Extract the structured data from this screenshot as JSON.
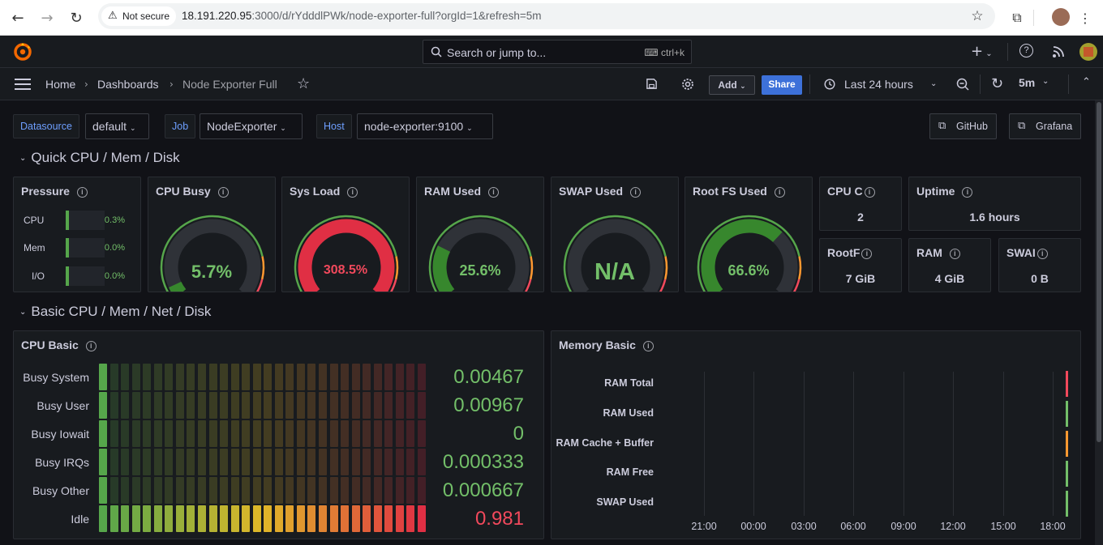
{
  "browser": {
    "secure_label": "Not secure",
    "url_host": "18.191.220.95",
    "url_rest": ":3000/d/rYdddlPWk/node-exporter-full?orgId=1&refresh=5m"
  },
  "topbar": {
    "search_placeholder": "Search or jump to...",
    "search_shortcut": "ctrl+k"
  },
  "breadcrumb": {
    "home": "Home",
    "dashboards": "Dashboards",
    "current": "Node Exporter Full"
  },
  "toolbar": {
    "add_label": "Add",
    "share_label": "Share",
    "time_range": "Last 24 hours",
    "refresh_interval": "5m"
  },
  "variables": {
    "datasource_label": "Datasource",
    "datasource_value": "default",
    "job_label": "Job",
    "job_value": "NodeExporter",
    "host_label": "Host",
    "host_value": "node-exporter:9100"
  },
  "links": {
    "github": "GitHub",
    "grafana": "Grafana"
  },
  "rows": {
    "quick": "Quick CPU / Mem / Disk",
    "basic": "Basic CPU / Mem / Net / Disk"
  },
  "colors": {
    "green": "#73bf69",
    "red": "#f2495c",
    "orange": "#ff9830",
    "accent": "#3d71d9"
  },
  "panels": {
    "pressure": {
      "title": "Pressure",
      "rows": [
        {
          "label": "CPU",
          "value": "0.3%"
        },
        {
          "label": "Mem",
          "value": "0.0%"
        },
        {
          "label": "I/O",
          "value": "0.0%"
        }
      ]
    },
    "cpu_busy": {
      "title": "CPU Busy",
      "value": "5.7%",
      "fraction": 0.057,
      "color": "#73bf69"
    },
    "sys_load": {
      "title": "Sys Load",
      "value": "308.5%",
      "fraction": 1.0,
      "color": "#f2495c"
    },
    "ram_used": {
      "title": "RAM Used",
      "value": "25.6%",
      "fraction": 0.256,
      "color": "#73bf69"
    },
    "swap_used": {
      "title": "SWAP Used",
      "value": "N/A",
      "fraction": 0,
      "color": "#73bf69"
    },
    "root_fs": {
      "title": "Root FS Used",
      "value": "66.6%",
      "fraction": 0.666,
      "color": "#73bf69"
    },
    "cpu_cores": {
      "title": "CPU C",
      "value": "2"
    },
    "uptime": {
      "title": "Uptime",
      "value": "1.6 hours"
    },
    "rootfs_total": {
      "title": "RootF",
      "value": "7 GiB"
    },
    "ram_total": {
      "title": "RAM",
      "value": "4 GiB"
    },
    "swap_total": {
      "title": "SWAI",
      "value": "0 B"
    },
    "cpu_basic": {
      "title": "CPU Basic",
      "items": [
        {
          "label": "Busy System",
          "value": "0.00467",
          "fraction": 0.00467,
          "color": "#73bf69"
        },
        {
          "label": "Busy User",
          "value": "0.00967",
          "fraction": 0.00967,
          "color": "#73bf69"
        },
        {
          "label": "Busy Iowait",
          "value": "0",
          "fraction": 0,
          "color": "#73bf69"
        },
        {
          "label": "Busy IRQs",
          "value": "0.000333",
          "fraction": 0.000333,
          "color": "#73bf69"
        },
        {
          "label": "Busy Other",
          "value": "0.000667",
          "fraction": 0.000667,
          "color": "#73bf69"
        },
        {
          "label": "Idle",
          "value": "0.981",
          "fraction": 0.981,
          "color": "#f2495c"
        }
      ]
    },
    "memory_basic": {
      "title": "Memory Basic",
      "series": [
        "RAM Total",
        "RAM Used",
        "RAM Cache + Buffer",
        "RAM Free",
        "SWAP Used"
      ],
      "series_colors": [
        "#f2495c",
        "#73bf69",
        "#ff9830",
        "#73bf69",
        "#73bf69"
      ],
      "x_ticks": [
        "21:00",
        "00:00",
        "03:00",
        "06:00",
        "09:00",
        "12:00",
        "15:00",
        "18:00"
      ]
    }
  }
}
